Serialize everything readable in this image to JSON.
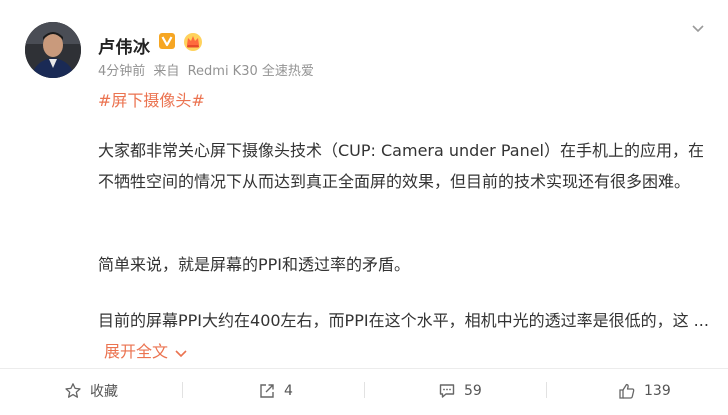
{
  "post": {
    "author": "卢伟冰",
    "time": "4分钟前",
    "source_prefix": "来自",
    "source": "Redmi K30 全速热爱",
    "hashtag": "#屏下摄像头#",
    "paragraphs": [
      "大家都非常关心屏下摄像头技术（CUP: Camera under Panel）在手机上的应用，在不牺牲空间的情况下从而达到真正全面屏的效果，但目前的技术实现还有很多困难。",
      "简单来说，就是屏幕的PPI和透过率的矛盾。",
      "目前的屏幕PPI大约在400左右，而PPI在这个水平，相机中光的透过率是很低的，这 ..."
    ],
    "expand_label": "展开全文"
  },
  "actions": {
    "favorite_label": "收藏",
    "repost_count": "4",
    "comment_count": "59",
    "like_count": "139"
  },
  "colors": {
    "accent": "#eb7350",
    "meta_gray": "#939393",
    "vip_badge": "#e6a23c"
  },
  "icons": [
    "avatar",
    "verified-badge-icon",
    "crown-icon",
    "close-icon",
    "chevron-down-icon",
    "star-icon",
    "share-icon",
    "comment-icon",
    "thumbs-up-icon"
  ]
}
